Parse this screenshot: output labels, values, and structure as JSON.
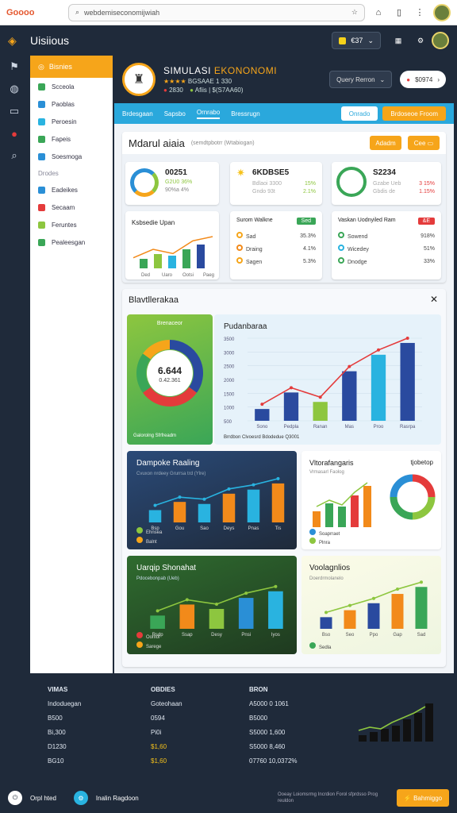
{
  "browser": {
    "brand": "Goooo",
    "url": "webdemiseconomijwiah"
  },
  "app": {
    "title": "Uisiious",
    "pill_value": "€37",
    "rail_icons": [
      "flag-icon",
      "globe-icon",
      "chat-icon",
      "record-icon",
      "search-icon"
    ]
  },
  "sidebar": {
    "head": "Bisnies",
    "items": [
      {
        "label": "Scceola",
        "color": "#3aa657"
      },
      {
        "label": "Paoblas",
        "color": "#2a8fd6"
      },
      {
        "label": "Peroesin",
        "color": "#29b3e0"
      },
      {
        "label": "Fapeis",
        "color": "#3aa657"
      },
      {
        "label": "Soesmoga",
        "color": "#2a8fd6"
      }
    ],
    "section": "Drodes",
    "items2": [
      {
        "label": "Eadeikes",
        "color": "#2a8fd6"
      },
      {
        "label": "Secaam",
        "color": "#e43b3b"
      },
      {
        "label": "Feruntes",
        "color": "#8dc63f"
      },
      {
        "label": "Pealeesgan",
        "color": "#3aa657"
      }
    ]
  },
  "header": {
    "title_prefix": "SIMULASI ",
    "title_highlight": "EKONONOMI",
    "rating": "★★★★",
    "rating_text": "BGSAAE 1 330",
    "stat1": "2830",
    "stat2": "Afiis | $(S7AA60)",
    "select_label": "Query Rerron",
    "button_value": "$0974"
  },
  "tabs": {
    "items": [
      "Brdesgaan",
      "Sapsbo",
      "Ornrabo",
      "Bressrugn"
    ],
    "active_index": 2,
    "btn_blue": "Onrado",
    "btn_orange": "Brdoseoe Froom"
  },
  "panel1": {
    "title": "Mdarul aiaia",
    "subtitle": "(semdtpbotrr (Wtabiogan)",
    "btn1": "Adadm",
    "btn2": "Cee"
  },
  "kpi": [
    {
      "value": "00251",
      "line1": "G2U0 36%",
      "line2": "90%a 4%"
    },
    {
      "value": "6KDBSE5",
      "line1": "15%",
      "line2": "2.1%",
      "sub1": "Bdlaoi 3300",
      "sub2": "Gndo 93t"
    },
    {
      "value": "S2234",
      "line1": "3 15%",
      "line2": "1.15%",
      "sub1": "Gzabe Ueb",
      "sub2": "Gbdis de"
    }
  ],
  "card_a": {
    "title": "Ksbsedie Upan",
    "xlabels": [
      "Ded",
      "Uaro",
      "Ootsi",
      "Paeg"
    ]
  },
  "card_b": {
    "title": "Surom Walkne",
    "badge": "Sed",
    "rows": [
      {
        "label": "Sad",
        "value": "35.3%",
        "color": "#f6a51a"
      },
      {
        "label": "Draing",
        "value": "4.1%",
        "color": "#f28a1a"
      },
      {
        "label": "Sagen",
        "value": "5.3%",
        "color": "#f6a51a"
      }
    ]
  },
  "card_c": {
    "title": "Vaskan Uodnyiled Ram",
    "badge": "&E",
    "rows": [
      {
        "label": "Sowend",
        "value": "918%",
        "color": "#3aa657"
      },
      {
        "label": "Wicedey",
        "value": "51%",
        "color": "#29b3e0"
      },
      {
        "label": "Dnodge",
        "value": "33%",
        "color": "#3aa657"
      }
    ]
  },
  "panel2": {
    "title": "Blavtllerakaa",
    "close": "✕"
  },
  "donut_card": {
    "title": "Brenaceor",
    "value": "6.644",
    "sub": "0.42.361",
    "legend": "Galorolng Sfrfreadm"
  },
  "big_chart": {
    "title": "Pudanbaraa",
    "yticks": [
      "3500",
      "3000",
      "2500",
      "2000",
      "1500",
      "1000",
      "500"
    ],
    "xlabels": [
      "Sono",
      "Pedpla",
      "Ranan",
      "Mas",
      "Proo",
      "Rasrpa"
    ],
    "legend": "Brrdbon Clvoesrd  Bdodedue  Q3001"
  },
  "chart3": {
    "title": "Dampoke Raaling",
    "subtitle": "Cvuxon nrdeey Grurrsa trd (Ylre)",
    "xlabels": [
      "Bsp",
      "Gou",
      "Sao",
      "Deys",
      "Pnas",
      "Tis"
    ],
    "legend": [
      "Ehnsea",
      "Balnt"
    ]
  },
  "chart4": {
    "title": "Vltorafangaris",
    "subtitle": "Vrmasarl Faolog",
    "donut_title": "tjobetop",
    "legend": [
      "Soaprraet",
      "Plnra"
    ]
  },
  "chart5": {
    "title": "Uarqip Shonahat",
    "subtitle": "Pdocebonpab (Ueb)",
    "xlabels": [
      "Rsdp",
      "Ssap",
      "Desy",
      "Pnsi",
      "Iyos"
    ],
    "legend": [
      "Ooniol",
      "Sarege"
    ]
  },
  "chart6": {
    "title": "Voolagnlios",
    "subtitle": "Doerdrmolanelo",
    "xlabels": [
      "Bso",
      "Seo",
      "Ppo",
      "Gap",
      "Sad"
    ],
    "legend": "Sedla"
  },
  "chart_data": [
    {
      "type": "line",
      "title": "",
      "series": [
        {
          "name": "",
          "values": [
            10,
            18,
            14,
            26,
            30
          ]
        }
      ],
      "categories": [
        "Ded",
        "Uaro",
        "Ootsi",
        "Paeg"
      ]
    },
    {
      "type": "bar",
      "title": "Pudanbaraa",
      "categories": [
        "Sono",
        "Pedpla",
        "Ranan",
        "Mas",
        "Proo",
        "Rasrpa"
      ],
      "series": [
        {
          "name": "",
          "values": [
            500,
            1200,
            800,
            2100,
            2800,
            3300
          ]
        }
      ],
      "ylim": [
        0,
        3500
      ]
    },
    {
      "type": "bar",
      "title": "Dampoke Raaling",
      "categories": [
        "Bsp",
        "Gou",
        "Sao",
        "Deys",
        "Pnas",
        "Tis"
      ],
      "series": [
        {
          "name": "",
          "values": [
            30,
            50,
            45,
            70,
            80,
            95
          ]
        }
      ]
    },
    {
      "type": "bar",
      "title": "Uarqip Shonahat",
      "categories": [
        "Rsdp",
        "Ssap",
        "Desy",
        "Pnsi",
        "Iyos"
      ],
      "series": [
        {
          "name": "",
          "values": [
            30,
            55,
            45,
            70,
            85
          ]
        }
      ]
    },
    {
      "type": "bar",
      "title": "Voolagnlios",
      "categories": [
        "Bso",
        "Seo",
        "Ppo",
        "Gap",
        "Sad"
      ],
      "series": [
        {
          "name": "",
          "values": [
            25,
            40,
            55,
            75,
            90
          ]
        }
      ]
    }
  ],
  "footer": {
    "col1": [
      "VIMAS",
      "Indoduegan",
      "B500",
      "Bi,300",
      "D1230",
      "BG10"
    ],
    "col2": [
      "OBDIES",
      "Goteohaan",
      "0594",
      "Pi0i",
      "$1,60",
      "$1,60"
    ],
    "col3": [
      "BRON",
      "A5000 0 1061",
      "B5000",
      "S5000 1,600",
      "S5000 8,460",
      "07760 10,0372%"
    ]
  },
  "bottom": {
    "left1": "Orpl hted",
    "left2": "Inalin Ragdoon",
    "caption": "Ooeay Loiomsrmg Incrdion Forol sfprdsso Prog reuldon",
    "button": "Bahmiggo"
  }
}
